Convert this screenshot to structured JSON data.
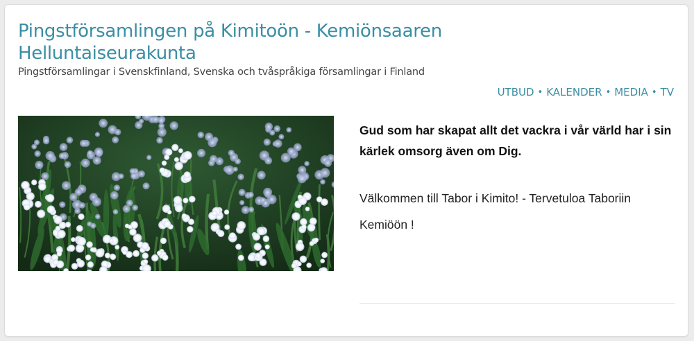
{
  "header": {
    "title": "Pingstförsamlingen på Kimitoön - Kemiönsaaren Helluntaiseurakunta",
    "subtitle": "Pingstförsamlingar i Svenskfinland, Svenska och tvåspråkiga församlingar i Finland"
  },
  "nav": {
    "items": [
      "UTBUD",
      "KALENDER",
      "MEDIA",
      "TV"
    ],
    "separator": "•"
  },
  "main": {
    "lead_line1": "Gud som har skapat allt det vackra i vår värld har i sin",
    "lead_line2": "kärlek omsorg även om Dig.",
    "welcome": "Välkommen till Tabor i Kimito! - Tervetuloa Taboriin Kemiöön !"
  },
  "colors": {
    "accent": "#3a8ea4",
    "background": "#ececec",
    "card": "#ffffff"
  }
}
